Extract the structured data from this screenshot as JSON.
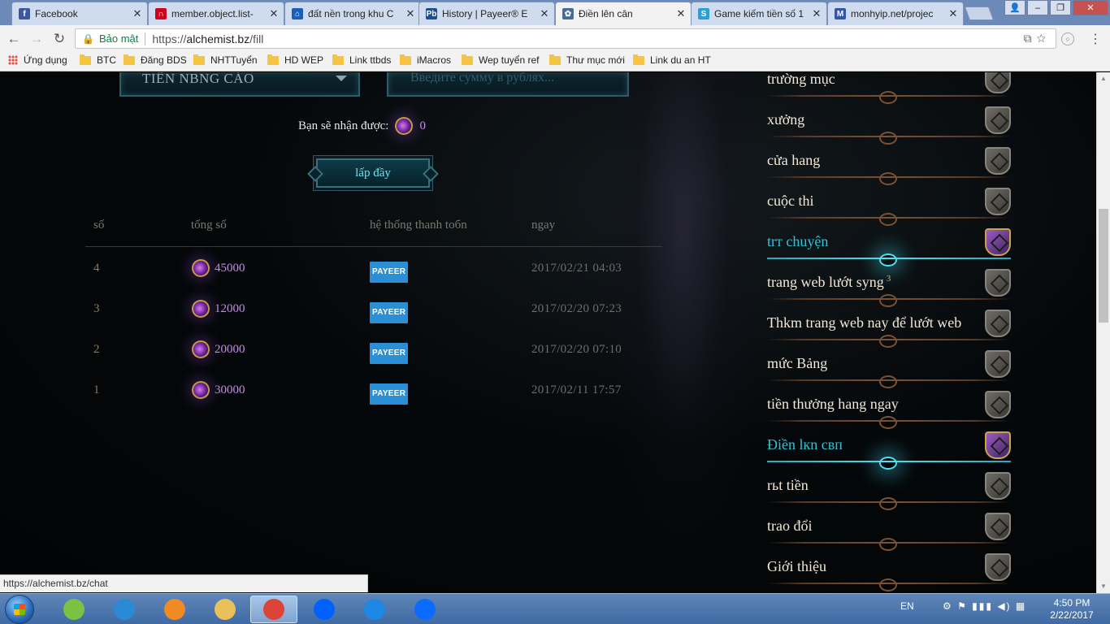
{
  "browser": {
    "tabs": [
      {
        "title": "Facebook",
        "close": "✕",
        "favicon_color": "#3b5998",
        "favicon_glyph": "f",
        "active": false
      },
      {
        "title": "member.object.list-",
        "close": "✕",
        "favicon_color": "#d0021b",
        "favicon_glyph": "∩",
        "active": false
      },
      {
        "title": "đất nền trong khu C",
        "close": "✕",
        "favicon_color": "#1a5fb4",
        "favicon_glyph": "⌂",
        "active": false
      },
      {
        "title": "History | Payeer® E",
        "close": "✕",
        "favicon_color": "#1a4f8b",
        "favicon_glyph": "Pb",
        "active": false
      },
      {
        "title": "Điền lên cân",
        "close": "✕",
        "favicon_color": "#4a6a9a",
        "favicon_glyph": "✿",
        "active": true
      },
      {
        "title": "Game kiếm tiền số 1",
        "close": "✕",
        "favicon_color": "#2a9fd6",
        "favicon_glyph": "S",
        "active": false
      },
      {
        "title": "monhyip.net/projec",
        "close": "✕",
        "favicon_color": "#3355aa",
        "favicon_glyph": "M",
        "active": false
      }
    ],
    "window_controls": {
      "minimize": "–",
      "restore": "❐",
      "close": "✕",
      "profile": "👤"
    },
    "nav": {
      "back": "←",
      "forward": "→",
      "reload": "↻"
    },
    "address": {
      "secure_label": "Bảo mật",
      "scheme": "https://",
      "host": "alchemist.bz",
      "path": "/fill",
      "lock": "🔒",
      "icons": "⧉☆"
    },
    "menu": "⋮",
    "ext": "○",
    "bookmarks": [
      {
        "label": "Ứng dụng",
        "type": "apps"
      },
      {
        "label": "BTC",
        "type": "folder"
      },
      {
        "label": "Đăng BDS",
        "type": "folder"
      },
      {
        "label": "NHTTuyển",
        "type": "folder"
      },
      {
        "label": "HD WEP",
        "type": "folder"
      },
      {
        "label": "Link ttbds",
        "type": "folder"
      },
      {
        "label": "iMacros",
        "type": "folder"
      },
      {
        "label": "Wep tuyển ref",
        "type": "folder"
      },
      {
        "label": "Thư mục mới",
        "type": "folder"
      },
      {
        "label": "Link du an HT",
        "type": "folder"
      }
    ],
    "status_url": "https://alchemist.bz/chat"
  },
  "page": {
    "currency_select": {
      "value": "TIỀN NBNG CÁO"
    },
    "amount_input": {
      "placeholder": "Введите сумму в рублях..."
    },
    "receive": {
      "label": "Bạn sẽ nhận được:",
      "value": "0"
    },
    "fill_button": "lấp đầy",
    "table": {
      "headers": [
        "số",
        "tổng số",
        "hệ thống thanh toбn",
        "ngay"
      ],
      "rows": [
        {
          "num": "4",
          "amount": "45000",
          "system": "PAYEER",
          "date": "2017/02/21 04:03"
        },
        {
          "num": "3",
          "amount": "12000",
          "system": "PAYEER",
          "date": "2017/02/20 07:23"
        },
        {
          "num": "2",
          "amount": "20000",
          "system": "PAYEER",
          "date": "2017/02/20 07:10"
        },
        {
          "num": "1",
          "amount": "30000",
          "system": "PAYEER",
          "date": "2017/02/11 17:57"
        }
      ]
    },
    "side_menu": [
      {
        "label": "trường mục",
        "active": false,
        "sup": ""
      },
      {
        "label": "xưởng",
        "active": false,
        "sup": ""
      },
      {
        "label": "cửa hang",
        "active": false,
        "sup": ""
      },
      {
        "label": "cuộc thi",
        "active": false,
        "sup": ""
      },
      {
        "label": "trт chuyện",
        "active": true,
        "sup": ""
      },
      {
        "label": "trang web lướt syng",
        "active": false,
        "sup": "3"
      },
      {
        "label": "Thkm trang web nay để lướt web",
        "active": false,
        "sup": ""
      },
      {
        "label": "mức Bảng",
        "active": false,
        "sup": ""
      },
      {
        "label": "tiền thưởng hang ngay",
        "active": false,
        "sup": ""
      },
      {
        "label": "Điền lкn свп",
        "active": true,
        "sup": ""
      },
      {
        "label": "rьt tiền",
        "active": false,
        "sup": ""
      },
      {
        "label": "trao đổi",
        "active": false,
        "sup": ""
      },
      {
        "label": "Giới thiệu",
        "active": false,
        "sup": ""
      }
    ]
  },
  "taskbar": {
    "apps": [
      {
        "name": "cốc-cốc",
        "color": "#7cc242",
        "active": false
      },
      {
        "name": "internet-explorer",
        "color": "#2a8ad6",
        "active": false
      },
      {
        "name": "media-player",
        "color": "#f08a24",
        "active": false
      },
      {
        "name": "file-explorer",
        "color": "#e8c15a",
        "active": false
      },
      {
        "name": "chrome",
        "color": "#db4437",
        "active": true
      },
      {
        "name": "dropbox",
        "color": "#0061ff",
        "active": false
      },
      {
        "name": "coc-coc-2",
        "color": "#1e88e5",
        "active": false
      },
      {
        "name": "zalo",
        "color": "#0b6bff",
        "active": false
      }
    ],
    "lang": "EN",
    "tray": "⚙ ⚑ ▮▮▮ ◀) ▦",
    "time": "4:50 PM",
    "date": "2/22/2017"
  }
}
